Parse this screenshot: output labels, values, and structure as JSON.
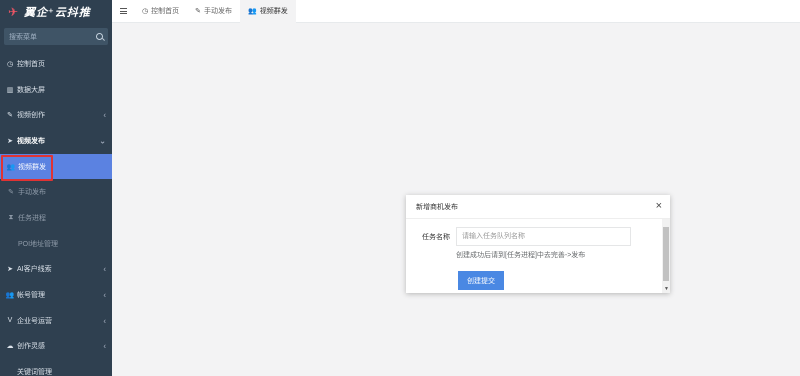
{
  "brand": {
    "title": "翼企⁺云抖推"
  },
  "sidebar": {
    "search_placeholder": "搜索菜单",
    "items": [
      {
        "label": "控制首页",
        "icon": "dashboard-icon",
        "glyph": "◷"
      },
      {
        "label": "数据大屏",
        "icon": "bar-chart-icon",
        "glyph": "▥"
      },
      {
        "label": "视频创作",
        "icon": "pencil-icon",
        "glyph": "✎"
      },
      {
        "label": "视频发布",
        "icon": "send-icon",
        "glyph": "➤"
      },
      {
        "label": "视频群发",
        "icon": "users-icon",
        "glyph": "👥"
      },
      {
        "label": "手动发布",
        "icon": "edit-icon",
        "glyph": "✎"
      },
      {
        "label": "任务进程",
        "icon": "hourglass-icon",
        "glyph": "⧗"
      },
      {
        "label": "POI地址管理",
        "icon": "",
        "glyph": ""
      },
      {
        "label": "AI客户线索",
        "icon": "send-icon",
        "glyph": "➤"
      },
      {
        "label": "帐号管理",
        "icon": "users-icon",
        "glyph": "👥"
      },
      {
        "label": "企业号运营",
        "icon": "vimeo-icon",
        "glyph": "V"
      },
      {
        "label": "创作灵感",
        "icon": "cloud-icon",
        "glyph": "☁"
      },
      {
        "label": "关键词管理",
        "icon": "",
        "glyph": ""
      }
    ]
  },
  "topbar": {
    "tabs": [
      {
        "label": "控制首页",
        "icon": "dashboard-icon",
        "glyph": "◷"
      },
      {
        "label": "手动发布",
        "icon": "edit-icon",
        "glyph": "✎"
      },
      {
        "label": "视频群发",
        "icon": "users-icon",
        "glyph": "👥"
      }
    ]
  },
  "modal": {
    "title": "新增商机发布",
    "close": "×",
    "field_label": "任务名称",
    "input_placeholder": "请输入任务队列名称",
    "input_value": "",
    "hint": "创建成功后请到[任务进程]中去完善->发布",
    "submit_label": "创建提交"
  },
  "colors": {
    "sidebar_bg": "#2f4050",
    "active_bg": "#5b82e1",
    "highlight_outline": "#e03333",
    "button_bg": "#4a88e3"
  }
}
